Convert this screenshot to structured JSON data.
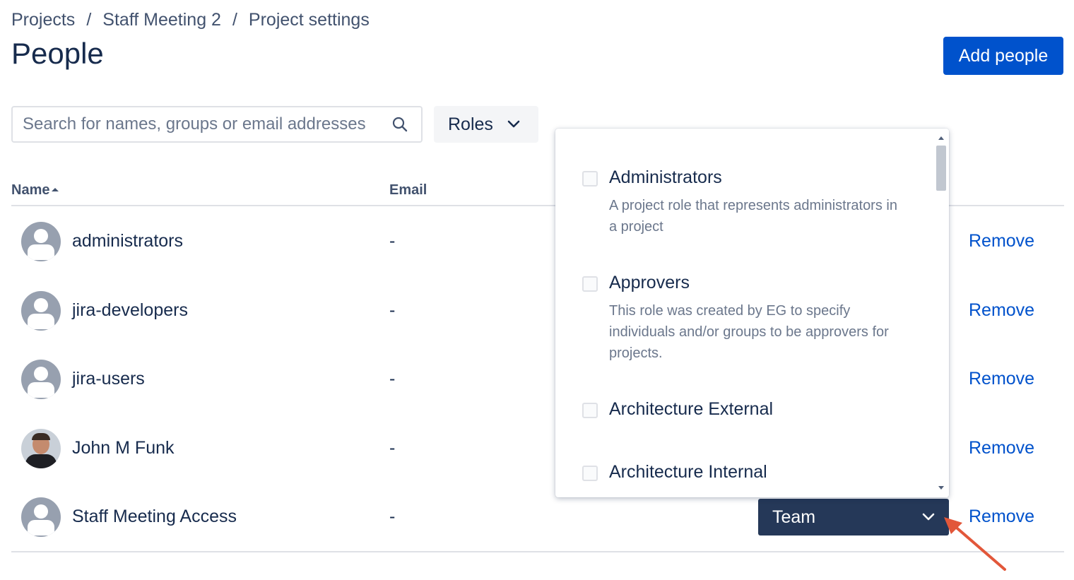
{
  "breadcrumb": {
    "items": [
      "Projects",
      "Staff Meeting 2",
      "Project settings"
    ],
    "separator": "/"
  },
  "page": {
    "title": "People",
    "add_button": "Add people"
  },
  "filters": {
    "search_placeholder": "Search for names, groups or email addresses",
    "roles_button": "Roles"
  },
  "table": {
    "columns": {
      "name": "Name",
      "email": "Email"
    },
    "sort": "name-ascending",
    "rows": [
      {
        "name": "administrators",
        "email": "-",
        "avatar": "group-avatar",
        "action": "Remove"
      },
      {
        "name": "jira-developers",
        "email": "-",
        "avatar": "group-avatar",
        "action": "Remove"
      },
      {
        "name": "jira-users",
        "email": "-",
        "avatar": "group-avatar",
        "action": "Remove"
      },
      {
        "name": "John M Funk",
        "email": "-",
        "avatar": "user-photo",
        "action": "Remove"
      },
      {
        "name": "Staff Meeting Access",
        "email": "-",
        "avatar": "group-avatar",
        "action": "Remove",
        "role": "Team"
      }
    ]
  },
  "roles_dropdown": {
    "options": [
      {
        "label": "Administrators",
        "description": "A project role that represents administrators in a project",
        "checked": false
      },
      {
        "label": "Approvers",
        "description": "This role was created by EG to specify individuals and/or groups to be approvers for projects.",
        "checked": false
      },
      {
        "label": "Architecture External",
        "description": "",
        "checked": false
      },
      {
        "label": "Architecture Internal",
        "description": "",
        "checked": false
      }
    ]
  },
  "colors": {
    "primary": "#0052cc",
    "text": "#172b4d",
    "subtle_text": "#6b778c",
    "team_select_bg": "#253858",
    "annotation_arrow": "#e2573a"
  }
}
